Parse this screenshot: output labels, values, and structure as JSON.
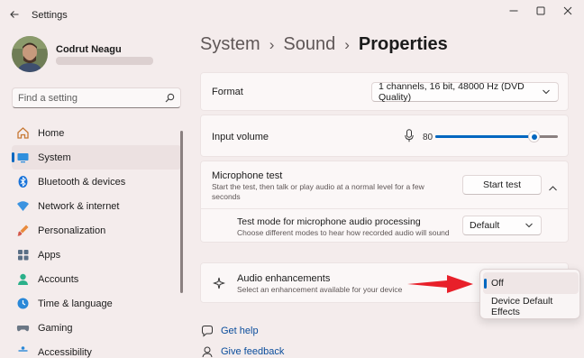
{
  "window": {
    "title": "Settings"
  },
  "profile": {
    "name": "Codrut Neagu"
  },
  "search": {
    "placeholder": "Find a setting"
  },
  "nav": {
    "items": [
      {
        "label": "Home",
        "icon": "home-icon"
      },
      {
        "label": "System",
        "icon": "system-icon",
        "active": true
      },
      {
        "label": "Bluetooth & devices",
        "icon": "bluetooth-icon"
      },
      {
        "label": "Network & internet",
        "icon": "wifi-icon"
      },
      {
        "label": "Personalization",
        "icon": "brush-icon"
      },
      {
        "label": "Apps",
        "icon": "apps-icon"
      },
      {
        "label": "Accounts",
        "icon": "accounts-icon"
      },
      {
        "label": "Time & language",
        "icon": "globe-clock-icon"
      },
      {
        "label": "Gaming",
        "icon": "gamepad-icon"
      },
      {
        "label": "Accessibility",
        "icon": "accessibility-icon"
      }
    ]
  },
  "breadcrumb": {
    "level1": "System",
    "level2": "Sound",
    "current": "Properties",
    "separator": "›"
  },
  "format": {
    "label": "Format",
    "value": "1 channels, 16 bit, 48000 Hz (DVD Quality)"
  },
  "input_volume": {
    "label": "Input volume",
    "value": "80",
    "level": 0.8
  },
  "mic_test": {
    "label": "Microphone test",
    "description": "Start the test, then talk or play audio at a normal level for a few seconds",
    "button": "Start test"
  },
  "test_mode": {
    "label": "Test mode for microphone audio processing",
    "description": "Choose different modes to hear how recorded audio will sound",
    "value": "Default"
  },
  "enhancements": {
    "label": "Audio enhancements",
    "description": "Select an enhancement available for your device",
    "options": [
      "Off",
      "Device Default Effects"
    ],
    "selected": "Off"
  },
  "links": {
    "help": "Get help",
    "feedback": "Give feedback"
  },
  "colors": {
    "accent": "#0067c0",
    "arrow": "#e8202a",
    "link": "#0a4d9c"
  }
}
